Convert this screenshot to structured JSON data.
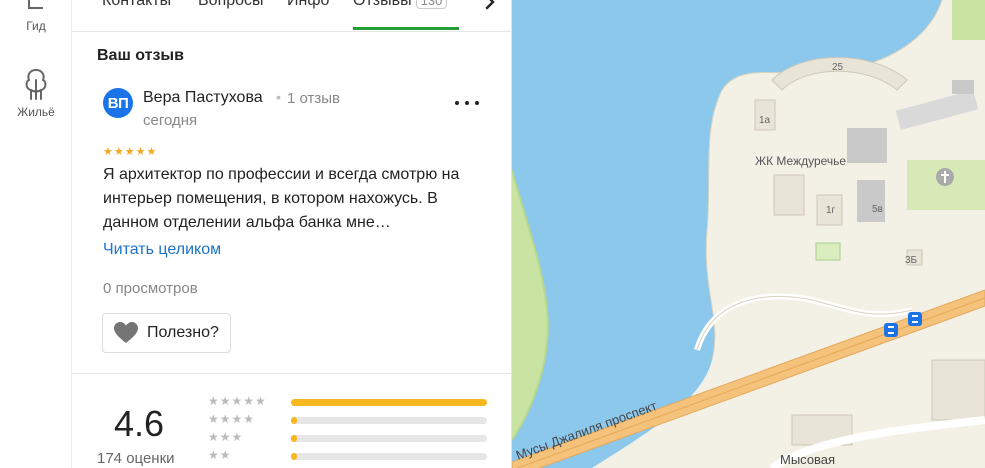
{
  "rail": {
    "items": [
      {
        "label": "Гид",
        "icon": "guide-icon"
      },
      {
        "label": "Жильё",
        "icon": "housing-icon"
      }
    ]
  },
  "tabs": [
    {
      "label": "Контакты"
    },
    {
      "label": "Вопросы"
    },
    {
      "label": "Инфо"
    },
    {
      "label": "Отзывы",
      "count": "130",
      "active": true
    }
  ],
  "review": {
    "section_title": "Ваш отзыв",
    "avatar_initials": "ВП",
    "author": "Вера Пастухова",
    "author_reviews": "1 отзыв",
    "date": "сегодня",
    "stars": "★★★★★",
    "text": "Я архитектор по профессии и всегда смотрю на интерьер помещения, в котором нахожусь. В данном отделении альфа банка мне…",
    "read_more": "Читать целиком",
    "views": "0 просмотров",
    "useful_label": "Полезно?"
  },
  "summary": {
    "rating": "4.6",
    "count": "174 оценки",
    "bars": [
      {
        "stars": "★★★★★",
        "fraction": 1.0
      },
      {
        "stars": "★★★★",
        "fraction": 0.03
      },
      {
        "stars": "★★★",
        "fraction": 0.03
      },
      {
        "stars": "★★",
        "fraction": 0.03
      }
    ]
  },
  "map": {
    "labels": {
      "complex": "ЖК Междуречье",
      "street": "Мусы Джалиля проспект",
      "street2": "Мысовая",
      "b25": "25",
      "b1a": "1а",
      "b1g": "1г",
      "b5v": "5в",
      "b3b": "3Б"
    },
    "colors": {
      "water": "#8cc8ec",
      "land": "#f3f0e6",
      "road": "#f4c27a",
      "park": "#c8e3a2"
    }
  }
}
